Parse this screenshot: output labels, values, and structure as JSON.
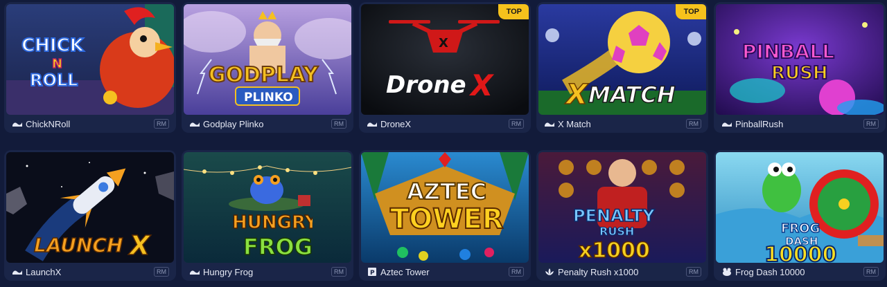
{
  "games": [
    {
      "name": "ChickNRoll",
      "title_art": [
        "CHICK",
        "N",
        "ROLL"
      ],
      "badge": "RM",
      "provider_icon": "provider-wave-icon",
      "top": "",
      "bg": "#3a4a8a"
    },
    {
      "name": "Godplay Plinko",
      "title_art": [
        "GODPLAY",
        "PLINKO"
      ],
      "badge": "RM",
      "provider_icon": "provider-wave-icon",
      "top": "",
      "bg": "#7a6fbf"
    },
    {
      "name": "DroneX",
      "title_art": [
        "Drone",
        "X"
      ],
      "badge": "RM",
      "provider_icon": "provider-wave-icon",
      "top": "TOP",
      "bg": "#101418"
    },
    {
      "name": "X Match",
      "title_art": [
        "X",
        "MATCH"
      ],
      "badge": "RM",
      "provider_icon": "provider-wave-icon",
      "top": "TOP",
      "bg": "#1b2b7a"
    },
    {
      "name": "PinballRush",
      "title_art": [
        "PINBALL",
        "RUSH"
      ],
      "badge": "RM",
      "provider_icon": "provider-wave-icon",
      "top": "",
      "bg": "#3a1a7a"
    },
    {
      "name": "LaunchX",
      "title_art": [
        "LAUNCH",
        "X"
      ],
      "badge": "RM",
      "provider_icon": "provider-wave-icon",
      "top": "",
      "bg": "#0c0f1e"
    },
    {
      "name": "Hungry Frog",
      "title_art": [
        "HUNGRY",
        "FROG"
      ],
      "badge": "RM",
      "provider_icon": "provider-wave-icon",
      "top": "",
      "bg": "#0f3a3a"
    },
    {
      "name": "Aztec Tower",
      "title_art": [
        "AZTEC",
        "TOWER"
      ],
      "badge": "RM",
      "provider_icon": "provider-p-icon",
      "top": "",
      "bg": "#1b6aa0"
    },
    {
      "name": "Penalty Rush x1000",
      "title_art": [
        "PENALTY",
        "RUSH",
        "x1000"
      ],
      "badge": "RM",
      "provider_icon": "provider-lotus-icon",
      "top": "",
      "bg": "#5a1a3a"
    },
    {
      "name": "Frog Dash 10000",
      "title_art": [
        "FROG",
        "DASH",
        "10000"
      ],
      "badge": "RM",
      "provider_icon": "provider-frog-icon",
      "top": "",
      "bg": "#2aa0d0"
    }
  ]
}
